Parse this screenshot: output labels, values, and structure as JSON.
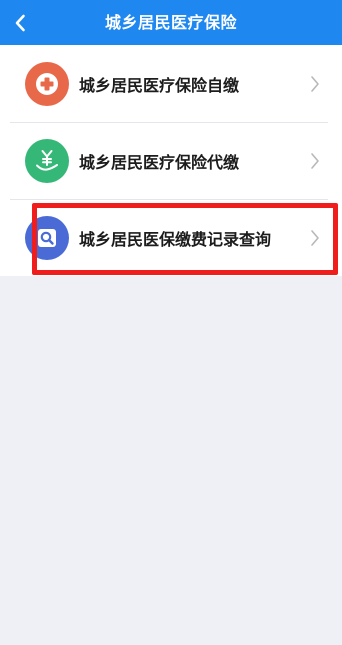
{
  "header": {
    "title": "城乡居民医疗保险",
    "back_icon": "chevron-left-icon"
  },
  "menu": {
    "items": [
      {
        "label": "城乡居民医疗保险自缴",
        "icon": "medical-cross-icon",
        "icon_color": "#e8684a"
      },
      {
        "label": "城乡居民医疗保险代缴",
        "icon": "money-hand-icon",
        "icon_color": "#35b877"
      },
      {
        "label": "城乡居民医保缴费记录查询",
        "icon": "document-search-icon",
        "icon_color": "#4a6bd6"
      }
    ],
    "chevron_icon": "chevron-right-icon"
  },
  "highlight": {
    "color": "#f01d1d",
    "target": "城乡居民医保缴费记录查询"
  }
}
